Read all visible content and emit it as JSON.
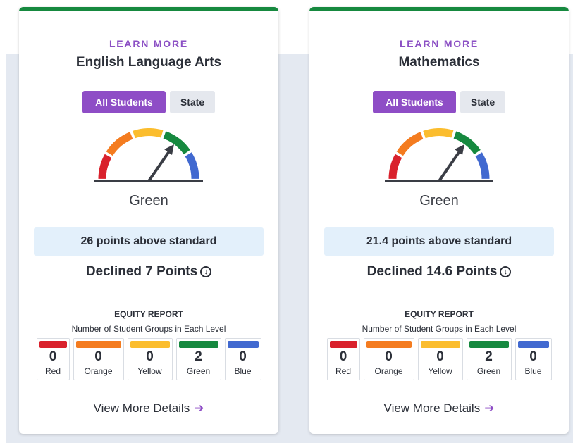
{
  "colors": {
    "red": "#d9212c",
    "orange": "#f47c20",
    "yellow": "#fbbd2e",
    "green": "#16893f",
    "blue": "#4169d0",
    "accent": "#8e4dc6",
    "status_bg": "#e3f0fb"
  },
  "cards": [
    {
      "learn_more": "LEARN MORE",
      "title": "English Language Arts",
      "toggle_all": "All Students",
      "toggle_state": "State",
      "gauge_level": "Green",
      "status": "26 points above standard",
      "change": "Declined 7 Points",
      "change_icon": "arrow-circle-down-icon",
      "equity_title": "EQUITY REPORT",
      "equity_subtitle": "Number of Student Groups in Each Level",
      "levels": [
        {
          "label": "Red",
          "count": "0",
          "color": "#d9212c"
        },
        {
          "label": "Orange",
          "count": "0",
          "color": "#f47c20"
        },
        {
          "label": "Yellow",
          "count": "0",
          "color": "#fbbd2e"
        },
        {
          "label": "Green",
          "count": "2",
          "color": "#16893f"
        },
        {
          "label": "Blue",
          "count": "0",
          "color": "#4169d0"
        }
      ],
      "details": "View More Details"
    },
    {
      "learn_more": "LEARN MORE",
      "title": "Mathematics",
      "toggle_all": "All Students",
      "toggle_state": "State",
      "gauge_level": "Green",
      "status": "21.4 points above standard",
      "change": "Declined 14.6 Points",
      "change_icon": "arrow-circle-down-icon",
      "equity_title": "EQUITY REPORT",
      "equity_subtitle": "Number of Student Groups in Each Level",
      "levels": [
        {
          "label": "Red",
          "count": "0",
          "color": "#d9212c"
        },
        {
          "label": "Orange",
          "count": "0",
          "color": "#f47c20"
        },
        {
          "label": "Yellow",
          "count": "0",
          "color": "#fbbd2e"
        },
        {
          "label": "Green",
          "count": "2",
          "color": "#16893f"
        },
        {
          "label": "Blue",
          "count": "0",
          "color": "#4169d0"
        }
      ],
      "details": "View More Details"
    }
  ]
}
